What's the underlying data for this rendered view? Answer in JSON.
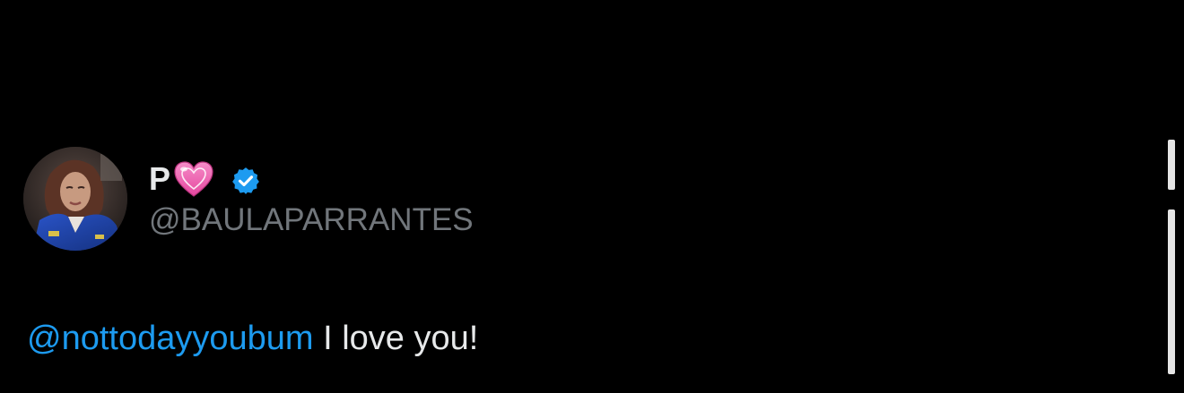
{
  "post": {
    "display_name": "P",
    "display_name_emoji": "pink-heart-icon",
    "verified_badge": "verified-icon",
    "handle": "@BAULAPARRANTES",
    "mention": "@nottodayyoubum",
    "text": " I love you!"
  },
  "colors": {
    "background": "#000000",
    "text_primary": "#e7e9ea",
    "text_secondary": "#71767b",
    "accent": "#1d9bf0",
    "heart": "#f063b4"
  }
}
